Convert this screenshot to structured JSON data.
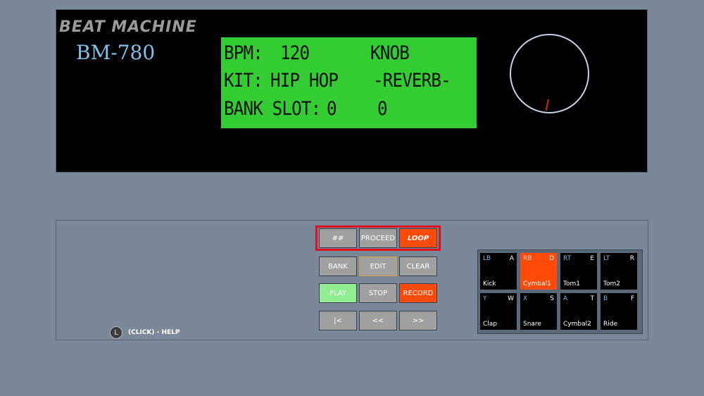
{
  "header": {
    "brand": "BEAT MACHINE",
    "model": "BM-780"
  },
  "lcd": {
    "bpm_label": "BPM:",
    "bpm_value": "120",
    "kit_label": "KIT:",
    "kit_value": "HIP HOP",
    "bank_label": "BANK SLOT:",
    "bank_value": "0",
    "knob_title": "KNOB",
    "knob_mode": "-REVERB-",
    "knob_value": "0"
  },
  "transport": {
    "hash_label": "##",
    "proceed_label": "PROCEED",
    "loop_label": "LOOP",
    "bank_label": "BANK",
    "edit_label": "EDIT",
    "clear_label": "CLEAR",
    "play_label": "PLAY",
    "stop_label": "STOP",
    "record_label": "RECORD",
    "start_label": "|<",
    "rewind_label": "<<",
    "forward_label": ">>"
  },
  "help": {
    "icon": "L",
    "text": "(CLICK) - HELP"
  },
  "pads": [
    {
      "button": "LB",
      "key": "A",
      "name": "Kick",
      "active": false
    },
    {
      "button": "RB",
      "key": "D",
      "name": "Cymbal1",
      "active": true
    },
    {
      "button": "RT",
      "key": "E",
      "name": "Tom1",
      "active": false
    },
    {
      "button": "LT",
      "key": "R",
      "name": "Tom2",
      "active": false
    },
    {
      "button": "Y",
      "key": "W",
      "name": "Clap",
      "active": false
    },
    {
      "button": "X",
      "key": "S",
      "name": "Snare",
      "active": false
    },
    {
      "button": "A",
      "key": "T",
      "name": "Cymbal2",
      "active": false
    },
    {
      "button": "B",
      "key": "F",
      "name": "Ride",
      "active": false
    }
  ],
  "colors": {
    "background": "#7a8899",
    "lcd": "#33cc33",
    "accent_orange": "#ff4a08",
    "play_green": "#90ee90",
    "frame_red": "#e0101e"
  }
}
